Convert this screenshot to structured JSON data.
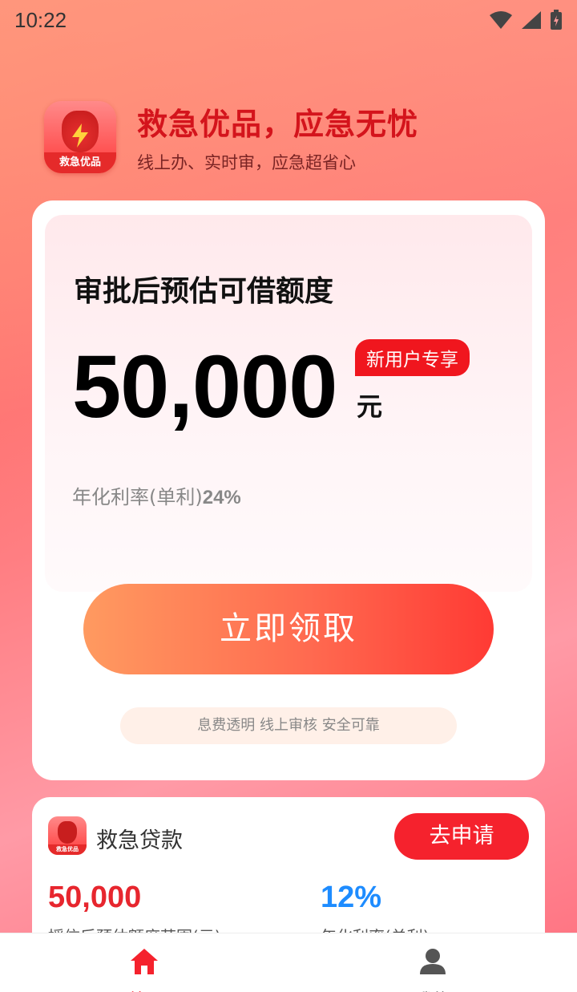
{
  "status_bar": {
    "time": "10:22"
  },
  "brand": {
    "title": "救急优品，应急无忧",
    "subtitle": "线上办、实时审，应急超省心",
    "icon_label": "救急优品"
  },
  "main_card": {
    "limit_title": "审批后预估可借额度",
    "amount": "50,000",
    "unit": "元",
    "badge": "新用户专享",
    "rate_label": "年化利率(单利)",
    "rate_value": "24%",
    "apply_button": "立即领取",
    "safety_note": "息费透明 线上审核 安全可靠"
  },
  "product_card": {
    "name": "救急贷款",
    "apply_button": "去申请",
    "amount": "50,000",
    "amount_label": "授信后预估额度范围(元)",
    "rate": "12%",
    "rate_label": "年化利率(单利)"
  },
  "tab_bar": {
    "items": [
      {
        "label": "首页",
        "icon": "home-icon",
        "active": true
      },
      {
        "label": "我的",
        "icon": "user-icon",
        "active": false
      }
    ]
  },
  "colors": {
    "accent_red": "#f5222d",
    "brand_title": "#d4141c",
    "rate_blue": "#1e8cff"
  }
}
